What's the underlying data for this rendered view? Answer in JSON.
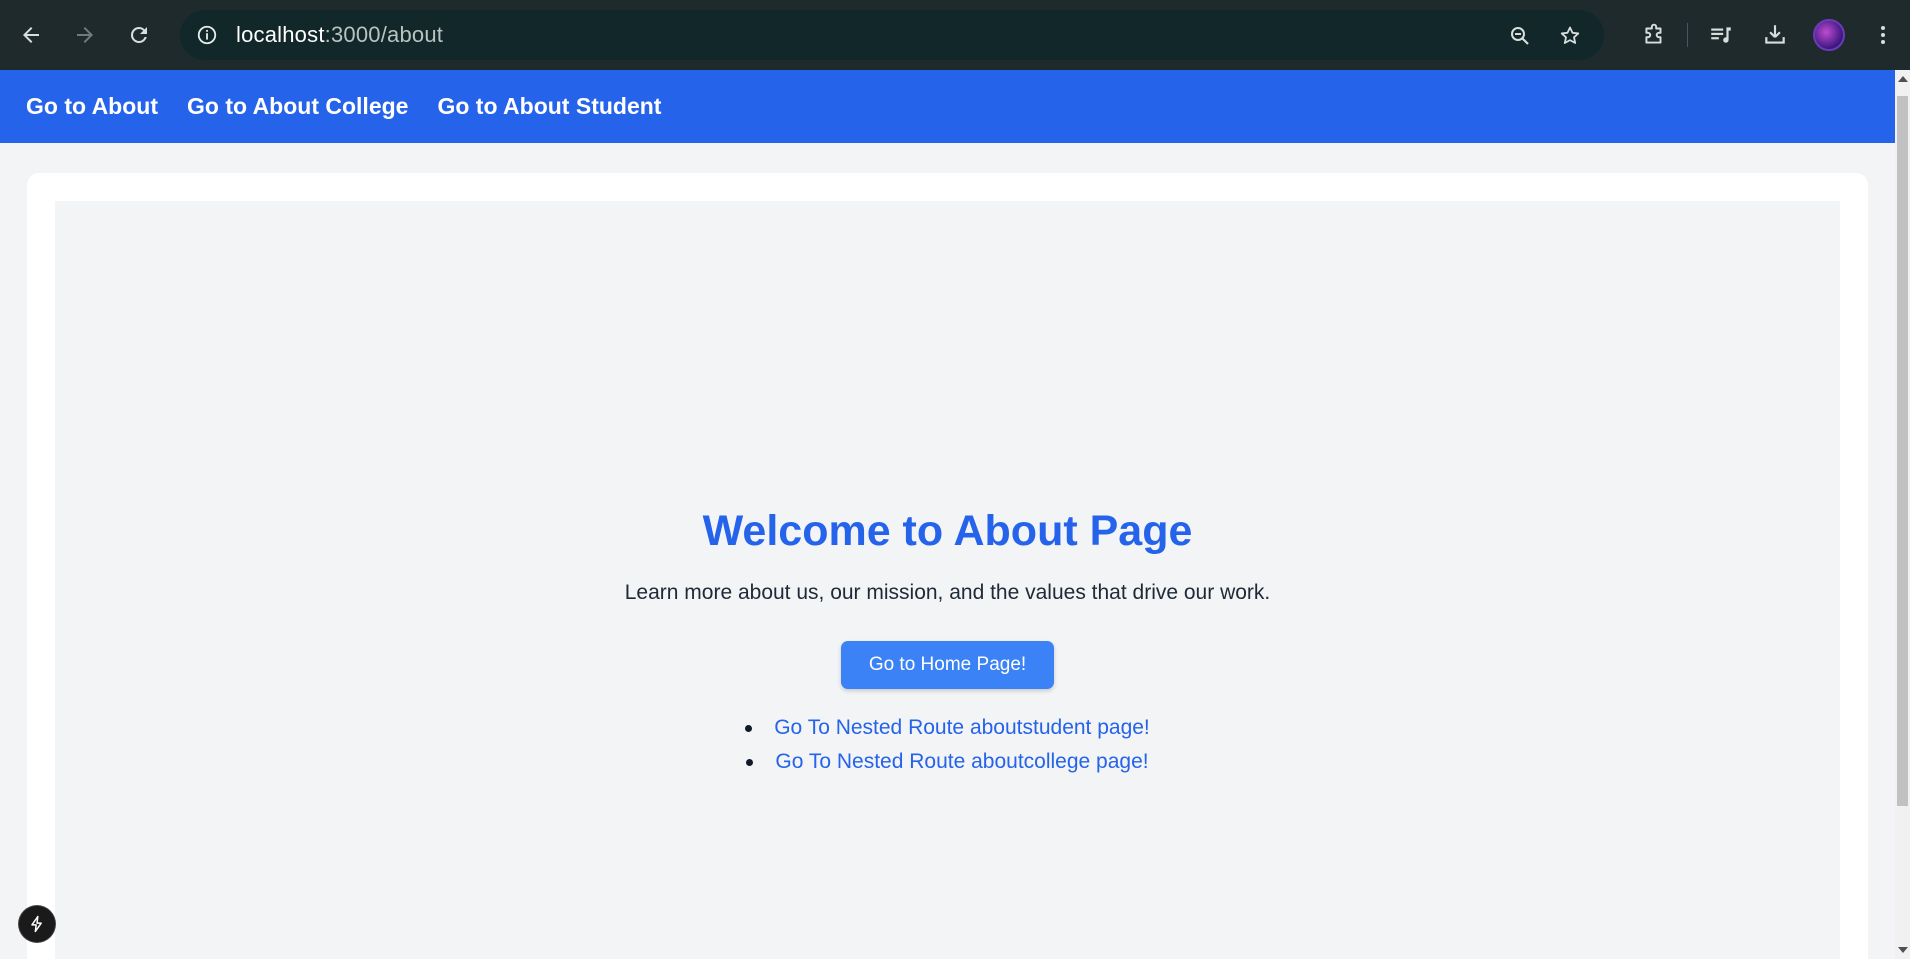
{
  "browser": {
    "url_host": "localhost",
    "url_rest": ":3000/about"
  },
  "appnav": {
    "links": [
      {
        "label": "Go to About"
      },
      {
        "label": "Go to About College"
      },
      {
        "label": "Go to About Student"
      }
    ]
  },
  "main": {
    "title": "Welcome to About Page",
    "subtitle": "Learn more about us, our mission, and the values that drive our work.",
    "home_button": "Go to Home Page!",
    "nested_links": [
      {
        "label": "Go To Nested Route aboutstudent page!"
      },
      {
        "label": "Go To Nested Route aboutcollege page!"
      }
    ]
  },
  "colors": {
    "nav_bg": "#2563eb",
    "title": "#2563eb",
    "button": "#3b82f6",
    "chrome": "#1f2a2c"
  },
  "icons": [
    "back-icon",
    "forward-icon",
    "reload-icon",
    "site-info-icon",
    "zoom-icon",
    "bookmark-star-icon",
    "extensions-icon",
    "media-controls-icon",
    "download-icon",
    "profile-avatar",
    "more-menu-icon",
    "nextjs-dev-indicator-icon"
  ]
}
